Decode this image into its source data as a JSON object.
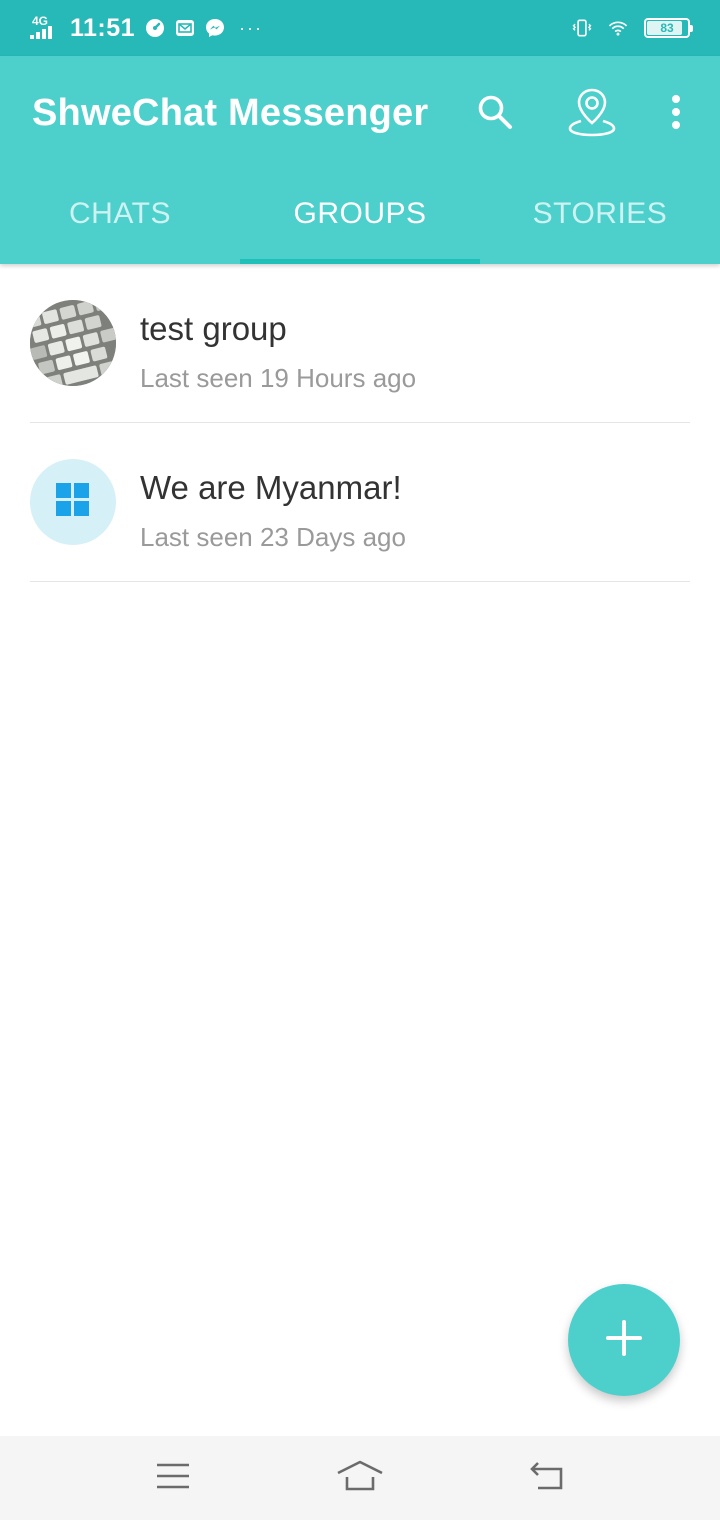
{
  "status_bar": {
    "network": "4G",
    "time": "11:51",
    "more": "···",
    "battery": "83",
    "battery_level": 0.83
  },
  "app_bar": {
    "title": "ShweChat Messenger",
    "icons": [
      "search-icon",
      "location-pin-icon",
      "more-vert-icon"
    ]
  },
  "tabs": [
    {
      "label": "CHATS",
      "active": false
    },
    {
      "label": "GROUPS",
      "active": true
    },
    {
      "label": "STORIES",
      "active": false
    }
  ],
  "groups": [
    {
      "name": "test group",
      "last_seen": "Last seen 19 Hours ago",
      "avatar": "keyboard-photo"
    },
    {
      "name": "We are Myanmar!",
      "last_seen": "Last seen 23 Days ago",
      "avatar": "grid-placeholder-icon"
    }
  ],
  "colors": {
    "status_bar": "#27b9b7",
    "app_bar": "#4dd0cc",
    "tab_indicator": "#1fc0b8",
    "placeholder_icon": "#1aa3e8"
  },
  "fab": {
    "icon": "plus-icon"
  },
  "nav_bar": {
    "icons": [
      "menu-icon",
      "home-icon",
      "back-icon"
    ]
  }
}
